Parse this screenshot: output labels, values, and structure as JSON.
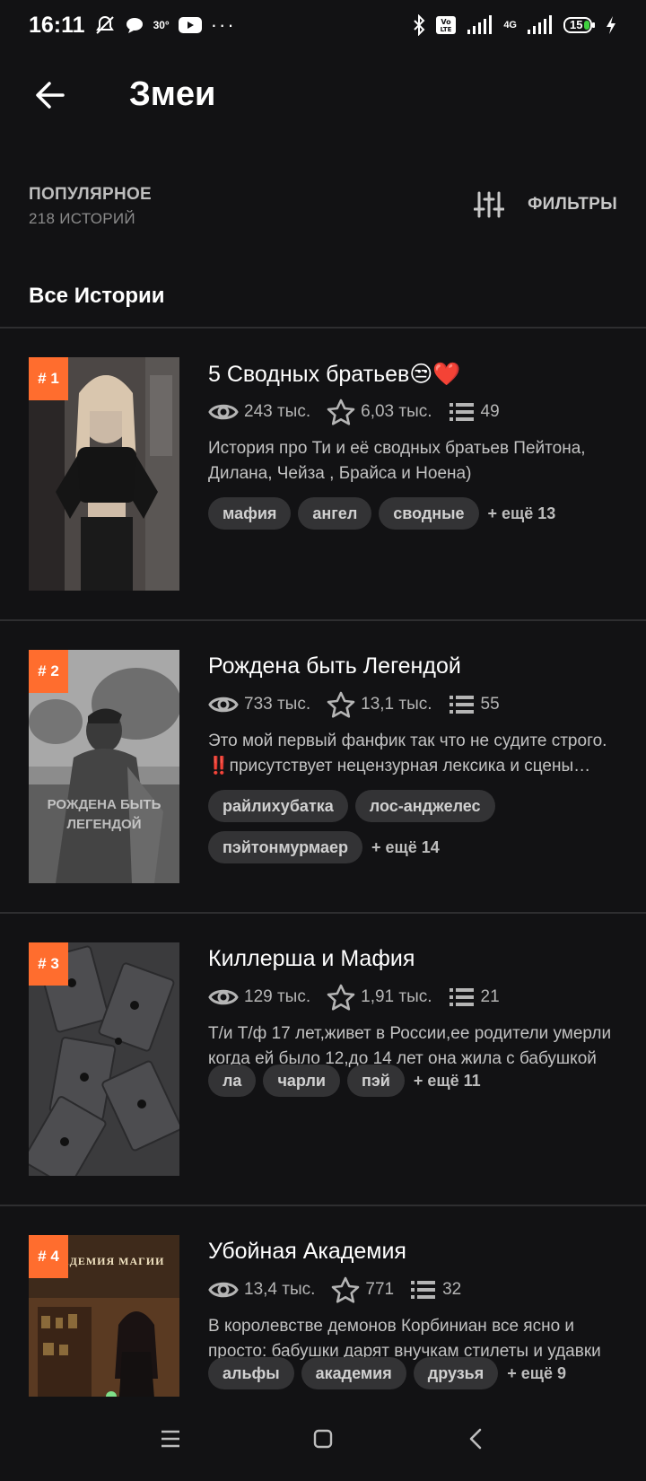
{
  "status_bar": {
    "time": "16:11",
    "temperature": "30°",
    "network": "4G",
    "battery": "15"
  },
  "header": {
    "title": "Змеи",
    "back_icon": "arrow-left-icon"
  },
  "sort": {
    "label": "ПОПУЛЯРНОЕ",
    "count": "218 ИСТОРИЙ"
  },
  "filters": {
    "label": "ФИЛЬТРЫ",
    "icon": "sliders-icon"
  },
  "section_title": "Все Истории",
  "colors": {
    "background": "#121214",
    "accent": "#ff6d2e",
    "tag_bg": "#333335"
  },
  "stories": [
    {
      "rank": "# 1",
      "title": "5 Сводных братьев😒❤️",
      "views": "243 тыс.",
      "votes": "6,03 тыс.",
      "parts": "49",
      "description": "История про Ти и её сводных братьев Пейтона, Дилана, Чейза , Брайса и Ноена)",
      "tags": [
        "мафия",
        "ангел",
        "сводные"
      ],
      "more_tags": "+ ещё 13"
    },
    {
      "rank": "# 2",
      "title": "Рождена быть Легендой",
      "views": "733 тыс.",
      "votes": "13,1 тыс.",
      "parts": "55",
      "description": "Это мой первый фанфик так что не судите строго. ‼️присутствует нецензурная лексика и сцены насилия",
      "tags": [
        "райлихубатка",
        "лос-анджелес",
        "пэйтонмурмаер"
      ],
      "more_tags": "+ ещё 14",
      "cover_text": "РОЖДЕНА БЫТЬ ЛЕГЕНДОЙ"
    },
    {
      "rank": "# 3",
      "title": "Киллерша и Мафия",
      "views": "129 тыс.",
      "votes": "1,91 тыс.",
      "parts": "21",
      "description": "Т/и Т/ф 17 лет,живет в России,ее родители умерли когда ей было 12,до 14 лет она жила с бабушкой",
      "tags": [
        "ла",
        "чарли",
        "пэй"
      ],
      "more_tags": "+ ещё 11"
    },
    {
      "rank": "# 4",
      "title": "Убойная Академия",
      "views": "13,4 тыс.",
      "votes": "771",
      "parts": "32",
      "description": "В королевстве демонов Корбиниан все ясно и просто: бабушки дарят внучкам стилеты и удавки",
      "tags": [
        "альфы",
        "академия",
        "друзья"
      ],
      "more_tags": "+ ещё 9",
      "cover_text": "АКАДЕМИЯ МАГИИ"
    }
  ],
  "nav": {
    "menu_icon": "menu-icon",
    "home_icon": "square-home-icon",
    "back_icon": "chevron-back-icon"
  }
}
